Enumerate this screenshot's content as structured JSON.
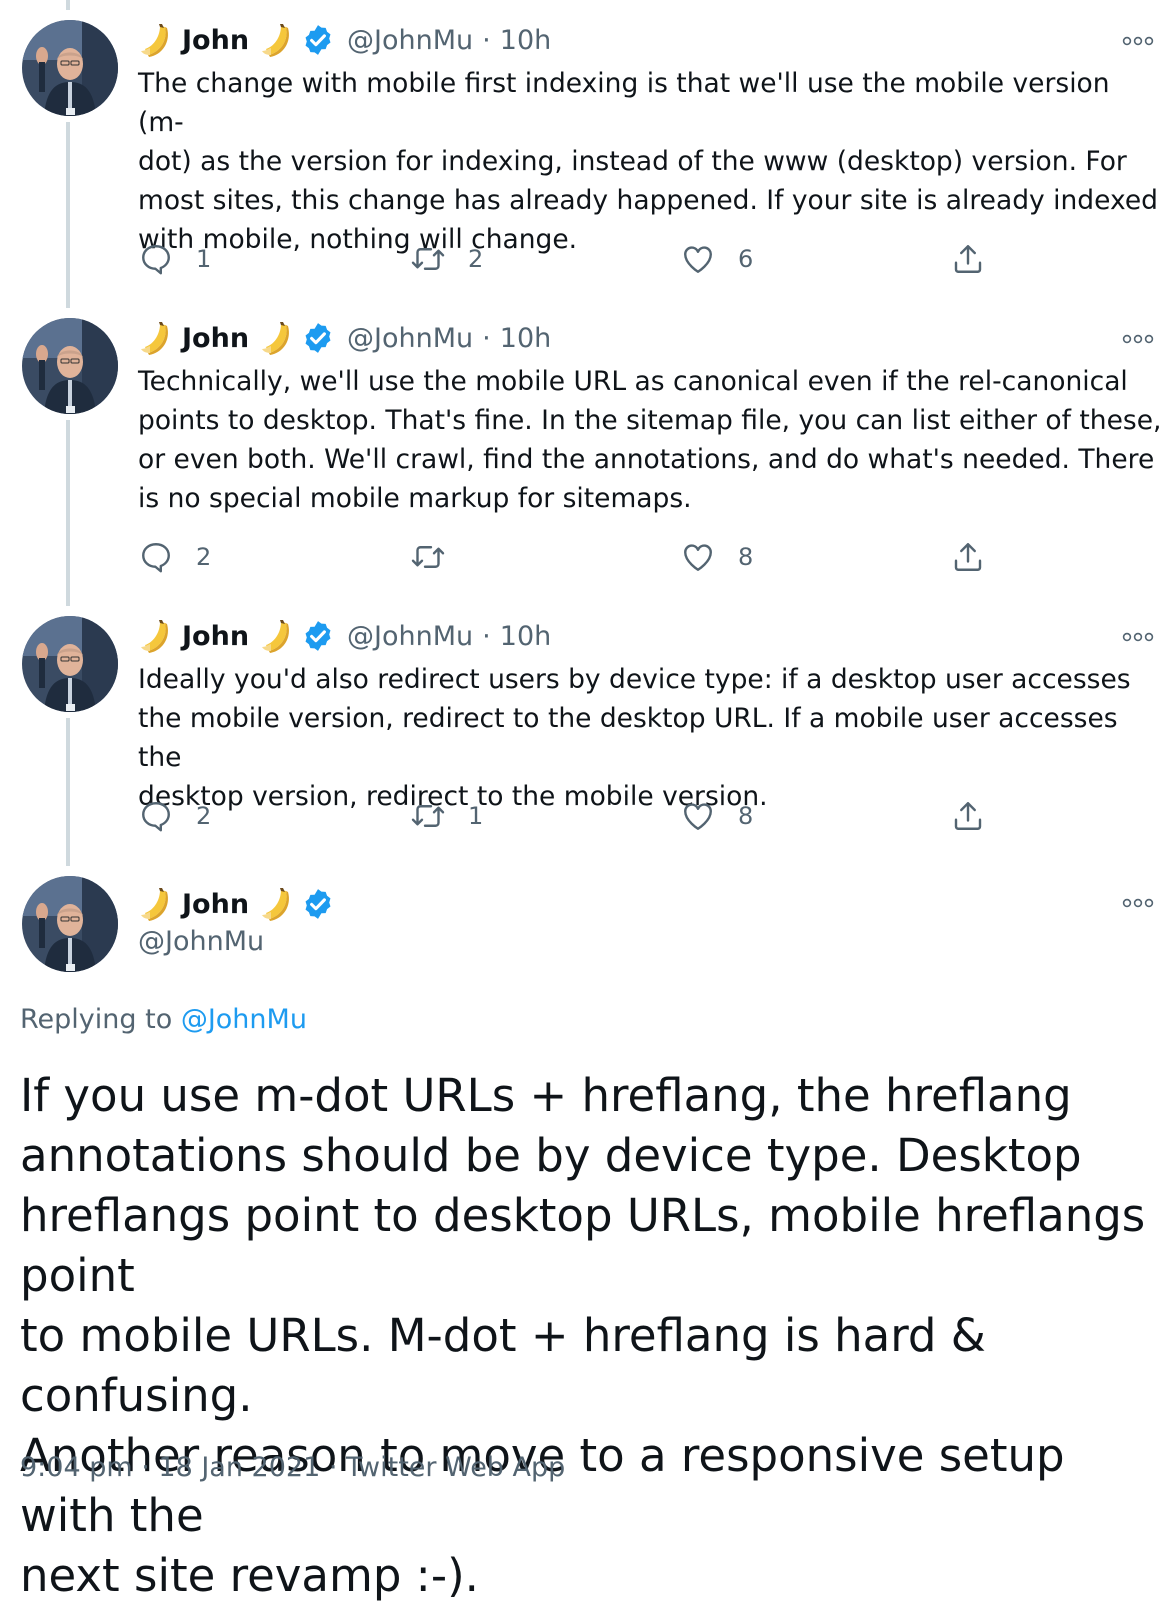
{
  "tweets": [
    {
      "name": "John",
      "handle": "@JohnMu",
      "sep": "·",
      "time": "10h",
      "text": "The change with mobile first indexing is that we'll use the mobile version (m-\ndot) as the version for indexing, instead of the www (desktop) version. For\nmost sites, this change has already happened. If your site is already indexed\nwith mobile, nothing will change.",
      "replies": "1",
      "retweets": "2",
      "likes": "6"
    },
    {
      "name": "John",
      "handle": "@JohnMu",
      "sep": "·",
      "time": "10h",
      "text": "Technically, we'll use the mobile URL as canonical even if the rel-canonical\npoints to desktop. That's fine. In the sitemap file, you can list either of these,\nor even both. We'll crawl, find the annotations, and do what's needed. There\nis no special mobile markup for sitemaps.",
      "replies": "2",
      "retweets": "",
      "likes": "8"
    },
    {
      "name": "John",
      "handle": "@JohnMu",
      "sep": "·",
      "time": "10h",
      "text": "Ideally you'd also redirect users by device type: if a desktop user accesses\nthe mobile version, redirect to the desktop URL. If a mobile user accesses the\ndesktop version, redirect to the mobile version.",
      "replies": "2",
      "retweets": "1",
      "likes": "8"
    }
  ],
  "main": {
    "name": "John",
    "handle": "@JohnMu",
    "replying_prefix": "Replying to ",
    "replying_handle": "@JohnMu",
    "text": "If you use m-dot URLs + hreflang, the hreflang\nannotations should be by device type. Desktop\nhreflangs point to desktop URLs, mobile hreflangs point\nto mobile URLs. M-dot + hreflang is hard & confusing.\nAnother reason to move to a responsive setup with the\nnext site revamp :-).",
    "meta": "9:04 pm · 18 Jan 2021 · Twitter Web App"
  },
  "icons": {
    "reply": "reply-icon",
    "retweet": "retweet-icon",
    "like": "heart-icon",
    "share": "share-icon",
    "more": "more-icon",
    "verified": "verified-badge-icon",
    "emoji": "banana-emoji-icon"
  },
  "colors": {
    "text": "#0f1419",
    "muted": "#536471",
    "accent": "#1d9bf0",
    "thread_line": "#cfd9de"
  }
}
